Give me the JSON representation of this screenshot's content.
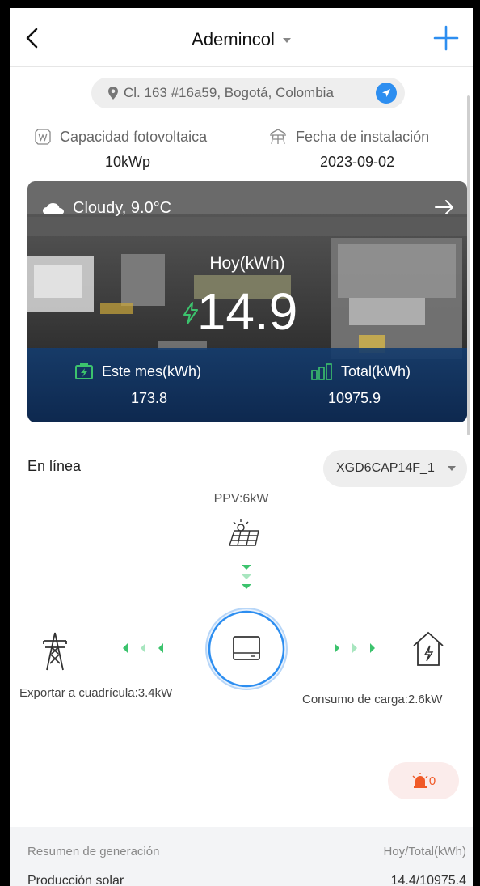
{
  "header": {
    "title": "Ademincol"
  },
  "location": {
    "address": "Cl. 163 #16a59, Bogotá, Colombia"
  },
  "info": {
    "capacity_label": "Capacidad fotovoltaica",
    "capacity_value": "10kWp",
    "install_label": "Fecha de instalación",
    "install_value": "2023-09-02"
  },
  "hero": {
    "weather": "Cloudy,  9.0°C",
    "today_label": "Hoy(kWh)",
    "today_value": "14.9",
    "month_label": "Este mes(kWh)",
    "month_value": "173.8",
    "total_label": "Total(kWh)",
    "total_value": "10975.9"
  },
  "status": {
    "label": "En línea",
    "device": "XGD6CAP14F_1"
  },
  "flow": {
    "ppv": "PPV:6kW",
    "grid_label": "Exportar a cuadrícula:3.4kW",
    "load_label": "Consumo de carga:2.6kW",
    "colors": {
      "arrow": "#3cc36d",
      "ring": "#2d8ef0",
      "alarm": "#f05a28"
    }
  },
  "alarm": {
    "count": "0"
  },
  "summary": {
    "title": "Resumen de generación",
    "unit": "Hoy/Total(kWh)",
    "row_label": "Producción solar",
    "row_value": "14.4/10975.4"
  },
  "icons": [
    "back-arrow-icon",
    "dropdown-caret-icon",
    "plus-icon",
    "location-pin-icon",
    "navigation-icon",
    "capacity-icon",
    "install-date-icon",
    "cloud-icon",
    "arrow-right-icon",
    "bolt-icon",
    "battery-charge-icon",
    "bar-chart-icon",
    "solar-panel-icon",
    "grid-tower-icon",
    "inverter-icon",
    "house-bolt-icon",
    "alarm-siren-icon"
  ]
}
